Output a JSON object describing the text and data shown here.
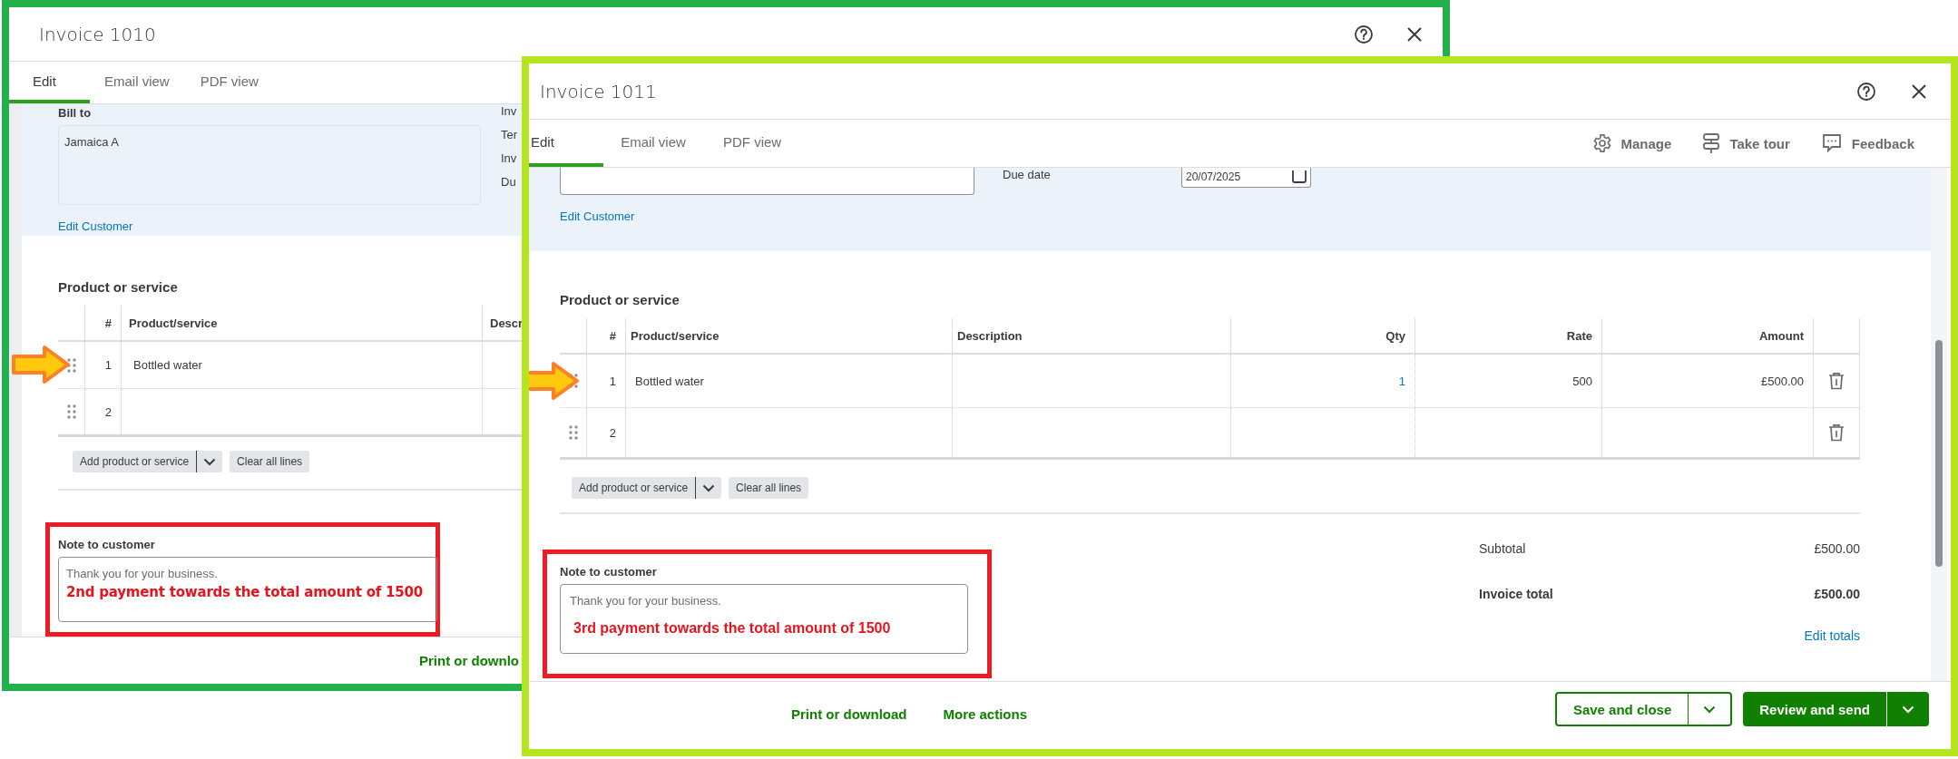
{
  "windows": [
    {
      "kind": "back",
      "title": "Invoice 1010",
      "tabs": [
        {
          "label": "Edit",
          "selected": true
        },
        {
          "label": "Email view",
          "selected": false
        },
        {
          "label": "PDF view",
          "selected": false
        }
      ],
      "customer": {
        "label": "Bill to",
        "value": "Jamaica A",
        "link": "Edit Customer"
      },
      "side_labels": [
        "Inv",
        "Ter",
        "Inv",
        "Du"
      ],
      "section_title": "Product or service",
      "columns": [
        "#",
        "Product/service",
        "Descr"
      ],
      "rows": [
        {
          "number": "1",
          "product": "Bottled water",
          "marked": true
        },
        {
          "number": "2",
          "marked": false
        }
      ],
      "line_buttons": [
        "Add product or service",
        "Clear all lines"
      ],
      "note": {
        "label": "Note to customer",
        "value": "Thank you for your business.",
        "annotation": "2nd payment towards the total amount of 1500",
        "highlighted": true
      },
      "footer_links": [
        "Print or downlo"
      ]
    },
    {
      "kind": "front",
      "title": "Invoice 1011",
      "tabs": [
        {
          "label": "Edit",
          "selected": true
        },
        {
          "label": "Email view",
          "selected": false
        },
        {
          "label": "PDF view",
          "selected": false
        }
      ],
      "toolbar": [
        "Manage",
        "Take tour",
        "Feedback"
      ],
      "customer": {
        "due_label": "Due date",
        "due_value": "20/07/2025",
        "link": "Edit Customer"
      },
      "section_title": "Product or service",
      "columns": [
        "#",
        "Product/service",
        "Description",
        "Qty",
        "Rate",
        "Amount"
      ],
      "rows": [
        {
          "number": "1",
          "product": "Bottled water",
          "qty": "1",
          "rate": "500",
          "amount": "£500.00",
          "marked": true
        },
        {
          "number": "2",
          "marked": false
        }
      ],
      "line_buttons": [
        "Add product or service",
        "Clear all lines"
      ],
      "note": {
        "label": "Note to customer",
        "value": "Thank you for your business.",
        "annotation": "3rd payment towards the total amount of 1500",
        "highlighted": true
      },
      "totals": [
        {
          "label": "Subtotal",
          "value": "£500.00",
          "bold": false
        },
        {
          "label": "Invoice total",
          "value": "£500.00",
          "bold": true
        }
      ],
      "totals_link": "Edit totals",
      "footer_links": [
        "Print or download",
        "More actions"
      ],
      "footer_buttons": [
        {
          "label": "Save and close",
          "primary": false
        },
        {
          "label": "Review and send",
          "primary": true
        }
      ]
    }
  ]
}
